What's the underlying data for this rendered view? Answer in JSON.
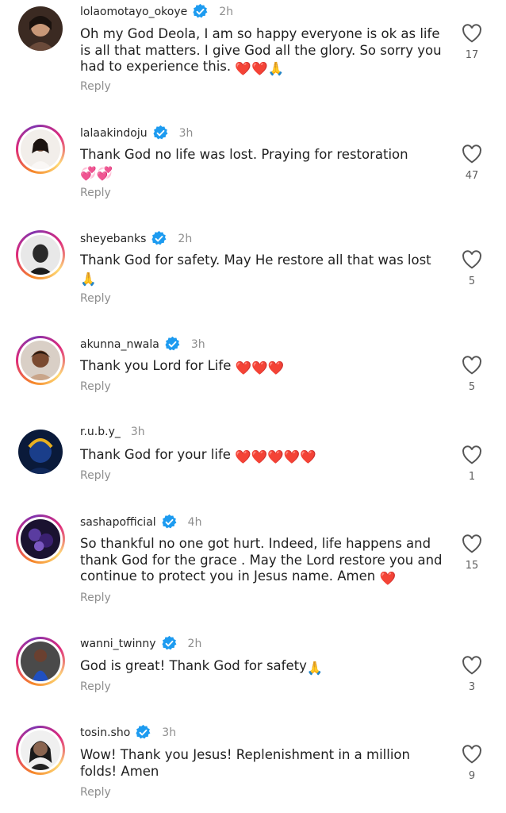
{
  "comments": [
    {
      "username": "lolaomotayo_okoye",
      "time": "2h",
      "text": "Oh my God Deola, I am so happy  everyone is ok as life is all that matters. I give God all the glory. So sorry you had to experience this.",
      "emoji": "❤️❤️🙏",
      "likes": "17",
      "reply": "Reply"
    },
    {
      "username": "lalaakindoju",
      "time": "3h",
      "text": "Thank God no life was lost. Praying for restoration",
      "emoji": "💞💞",
      "likes": "47",
      "reply": "Reply"
    },
    {
      "username": "sheyebanks",
      "time": "2h",
      "text": "Thank God for safety. May He restore all that was lost",
      "emoji": "🙏",
      "likes": "5",
      "reply": "Reply"
    },
    {
      "username": "akunna_nwala",
      "time": "3h",
      "text": "Thank you Lord for Life",
      "emoji": "❤️❤️❤️",
      "likes": "5",
      "reply": "Reply"
    },
    {
      "username": "r.u.b.y_",
      "time": "3h",
      "text": "Thank God for your life",
      "emoji": "❤️❤️❤️❤️❤️",
      "likes": "1",
      "reply": "Reply"
    },
    {
      "username": "sashapofficial",
      "time": "4h",
      "text": "So thankful no one got hurt. Indeed, life happens and thank God for the grace . May the Lord restore you and continue to protect you in Jesus name. Amen",
      "emoji": "❤️",
      "likes": "15",
      "reply": "Reply"
    },
    {
      "username": "wanni_twinny",
      "time": "2h",
      "text": "God is great! Thank God for safety",
      "emoji": "🙏",
      "likes": "3",
      "reply": "Reply"
    },
    {
      "username": "tosin.sho",
      "time": "3h",
      "text": "Wow! Thank you Jesus! Replenishment in a million folds! Amen",
      "emoji": "",
      "likes": "9",
      "reply": "Reply"
    }
  ]
}
